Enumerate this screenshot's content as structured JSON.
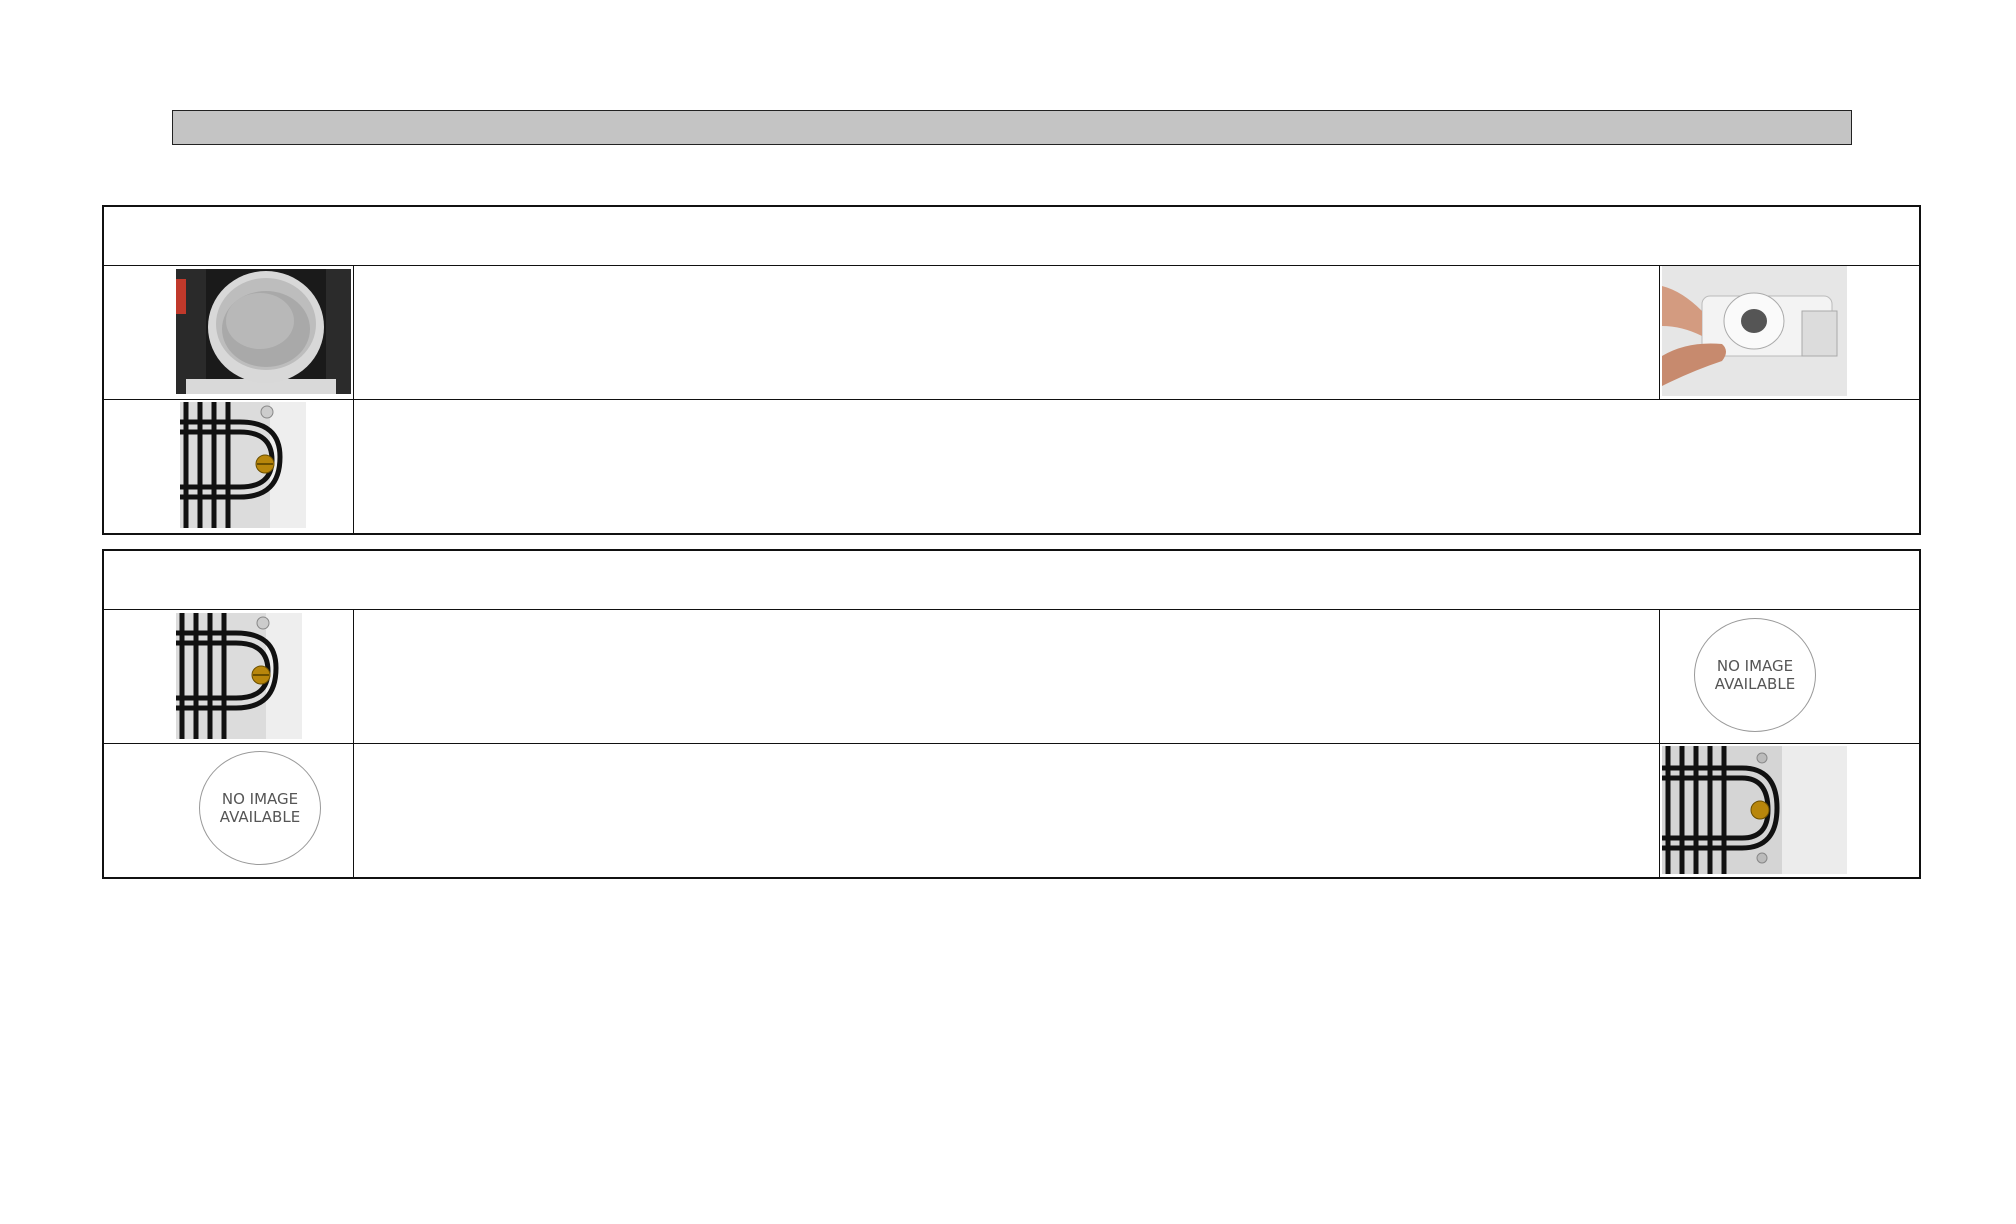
{
  "sections": [
    {
      "rows": [
        {
          "left": {
            "kind": "photo",
            "icon": "drip-tray-cup-photo"
          },
          "right": {
            "kind": "photo",
            "icon": "grommet-in-hand-photo"
          }
        },
        {
          "left": {
            "kind": "photo",
            "icon": "condenser-coil-photo"
          },
          "right": null
        }
      ]
    },
    {
      "rows": [
        {
          "left": {
            "kind": "photo",
            "icon": "condenser-coil-photo"
          },
          "right": {
            "kind": "placeholder",
            "text": "NO IMAGE\nAVAILABLE"
          }
        },
        {
          "left": {
            "kind": "placeholder",
            "text": "NO IMAGE\nAVAILABLE"
          },
          "right": {
            "kind": "photo",
            "icon": "condenser-coil-photo"
          }
        }
      ]
    }
  ]
}
